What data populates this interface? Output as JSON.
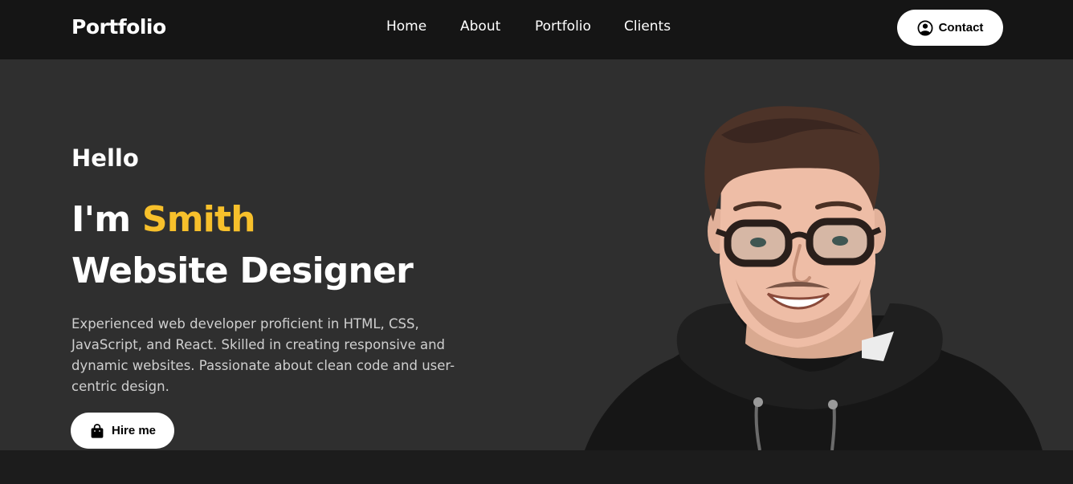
{
  "header": {
    "brand": "Portfolio",
    "nav": [
      "Home",
      "About",
      "Portfolio",
      "Clients"
    ],
    "contact_label": "Contact",
    "contact_icon": "user-circle-icon"
  },
  "hero": {
    "greeting": "Hello",
    "intro": "I'm",
    "name": "Smith",
    "role": "Website Designer",
    "bio": "Experienced web developer proficient in HTML, CSS, JavaScript, and React. Skilled in creating responsive and dynamic websites. Passionate about clean code and user-centric design.",
    "hire_label": "Hire me",
    "hire_icon": "shopping-bag-icon",
    "accent_color": "#f7c02b"
  }
}
